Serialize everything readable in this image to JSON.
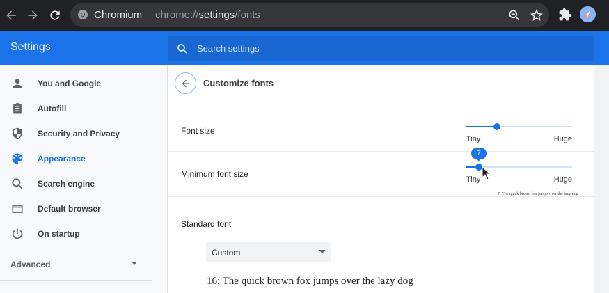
{
  "browser": {
    "site_name": "Chromium",
    "url_scheme": "chrome://",
    "url_host": "settings",
    "url_path": "/fonts"
  },
  "header": {
    "title": "Settings",
    "search_placeholder": "Search settings"
  },
  "sidebar": {
    "items": [
      {
        "label": "You and Google",
        "icon": "person-icon",
        "active": false
      },
      {
        "label": "Autofill",
        "icon": "clipboard-icon",
        "active": false
      },
      {
        "label": "Security and Privacy",
        "icon": "shield-icon",
        "active": false
      },
      {
        "label": "Appearance",
        "icon": "palette-icon",
        "active": true
      },
      {
        "label": "Search engine",
        "icon": "search-icon",
        "active": false
      },
      {
        "label": "Default browser",
        "icon": "browser-window-icon",
        "active": false
      },
      {
        "label": "On startup",
        "icon": "power-icon",
        "active": false
      }
    ],
    "advanced_label": "Advanced"
  },
  "page": {
    "title": "Customize fonts",
    "font_size": {
      "label": "Font size",
      "min_label": "Tiny",
      "max_label": "Huge",
      "level": 0.29
    },
    "minimum_font_size": {
      "label": "Minimum font size",
      "min_label": "Tiny",
      "max_label": "Huge",
      "value": "7",
      "level": 0.12,
      "sample": "7: The quick brown fox jumps over the lazy dog"
    },
    "standard_font": {
      "label": "Standard font",
      "selected": "Custom",
      "sample": "16: The quick brown fox jumps over the lazy dog"
    }
  },
  "colors": {
    "accent": "#1a73e8",
    "toolbar": "#202124",
    "track": "#d2e3fc"
  }
}
